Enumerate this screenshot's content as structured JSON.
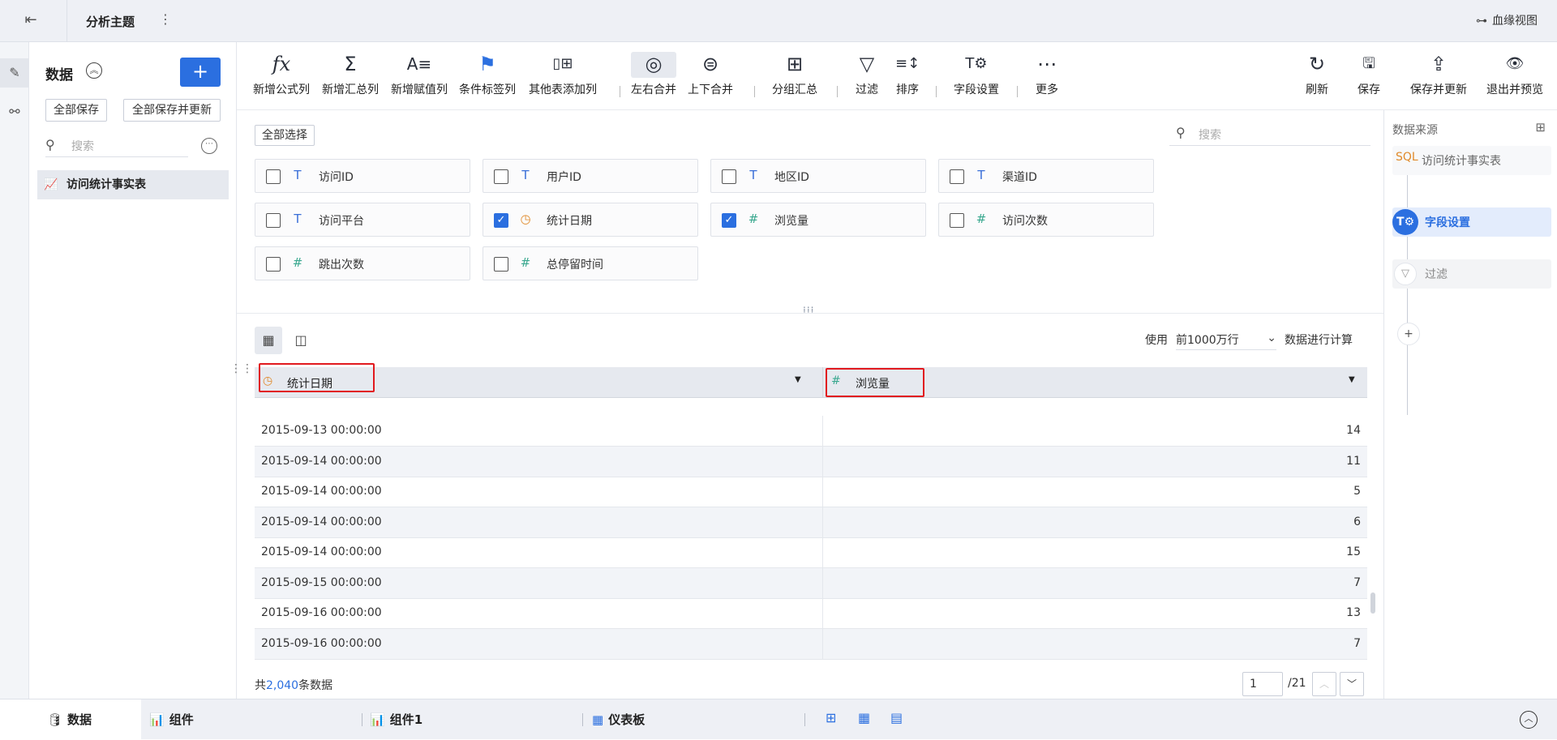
{
  "topbar": {
    "back_icon": "exit-icon",
    "title": "分析主题",
    "more": "⋮",
    "lineage_label": "血缘视图"
  },
  "rail": {
    "items": [
      "edit-data-icon",
      "relation-icon"
    ]
  },
  "data_panel": {
    "title": "数据",
    "add_label": "+",
    "save_all": "全部保存",
    "save_all_update": "全部保存并更新",
    "search_placeholder": "搜索",
    "items": [
      {
        "label": "访问统计事实表"
      }
    ]
  },
  "toolbar": {
    "left": [
      {
        "label": "新增公式列",
        "icon": "fx"
      },
      {
        "label": "新增汇总列",
        "icon": "Σ"
      },
      {
        "label": "新增赋值列",
        "icon": "A≡"
      },
      {
        "label": "条件标签列",
        "icon": "⚑"
      },
      {
        "label": "其他表添加列",
        "icon": "▯⊞"
      },
      {
        "label": "左右合并",
        "icon": "◎"
      },
      {
        "label": "上下合并",
        "icon": "⊜"
      },
      {
        "label": "分组汇总",
        "icon": "⊞"
      },
      {
        "label": "过滤",
        "icon": "▽"
      },
      {
        "label": "排序",
        "icon": "≡↕"
      },
      {
        "label": "字段设置",
        "icon": "T⚙"
      },
      {
        "label": "更多",
        "icon": "⋯"
      }
    ],
    "right": [
      {
        "label": "刷新",
        "icon": "↻"
      },
      {
        "label": "保存",
        "icon": "🖫"
      },
      {
        "label": "保存并更新",
        "icon": "⇪"
      },
      {
        "label": "退出并预览",
        "icon": "👁"
      }
    ]
  },
  "fields_panel": {
    "select_all": "全部选择",
    "search_placeholder": "搜索",
    "fields": [
      {
        "name": "访问ID",
        "type": "T",
        "checked": false
      },
      {
        "name": "用户ID",
        "type": "T",
        "checked": false
      },
      {
        "name": "地区ID",
        "type": "T",
        "checked": false
      },
      {
        "name": "渠道ID",
        "type": "T",
        "checked": false
      },
      {
        "name": "访问平台",
        "type": "T",
        "checked": false
      },
      {
        "name": "统计日期",
        "type": "date",
        "checked": true
      },
      {
        "name": "浏览量",
        "type": "#",
        "checked": true
      },
      {
        "name": "访问次数",
        "type": "#",
        "checked": false
      },
      {
        "name": "跳出次数",
        "type": "#",
        "checked": false
      },
      {
        "name": "总停留时间",
        "type": "#",
        "checked": false
      }
    ],
    "check_mark": "✓"
  },
  "preview": {
    "use_label": "使用",
    "rows_option": "前1000万行",
    "compute_label": "数据进行计算",
    "columns": [
      {
        "name": "统计日期",
        "type": "date"
      },
      {
        "name": "浏览量",
        "type": "#"
      }
    ],
    "rows": [
      {
        "date": "2015-09-13 00:00:00",
        "value": "14"
      },
      {
        "date": "2015-09-14 00:00:00",
        "value": "11"
      },
      {
        "date": "2015-09-14 00:00:00",
        "value": "5"
      },
      {
        "date": "2015-09-14 00:00:00",
        "value": "6"
      },
      {
        "date": "2015-09-14 00:00:00",
        "value": "15"
      },
      {
        "date": "2015-09-15 00:00:00",
        "value": "7"
      },
      {
        "date": "2015-09-16 00:00:00",
        "value": "13"
      },
      {
        "date": "2015-09-16 00:00:00",
        "value": "7"
      }
    ],
    "total_prefix": "共",
    "total_count": "2,040",
    "total_suffix": "条数据",
    "page_value": "1",
    "page_total": "/21"
  },
  "right_panel": {
    "title": "数据来源",
    "steps": [
      {
        "label": "访问统计事实表",
        "state": "source"
      },
      {
        "label": "字段设置",
        "state": "current"
      },
      {
        "label": "过滤",
        "state": "disabled"
      }
    ],
    "add_step": "+"
  },
  "bottom": {
    "tabs": [
      {
        "label": "数据"
      },
      {
        "label": "组件"
      },
      {
        "label": "组件1"
      },
      {
        "label": "仪表板"
      }
    ]
  },
  "colors": {
    "accent": "#2b6fe0",
    "highlight": "#e1191e",
    "date_icon": "#e08a2b",
    "number_icon": "#3aa88f"
  }
}
